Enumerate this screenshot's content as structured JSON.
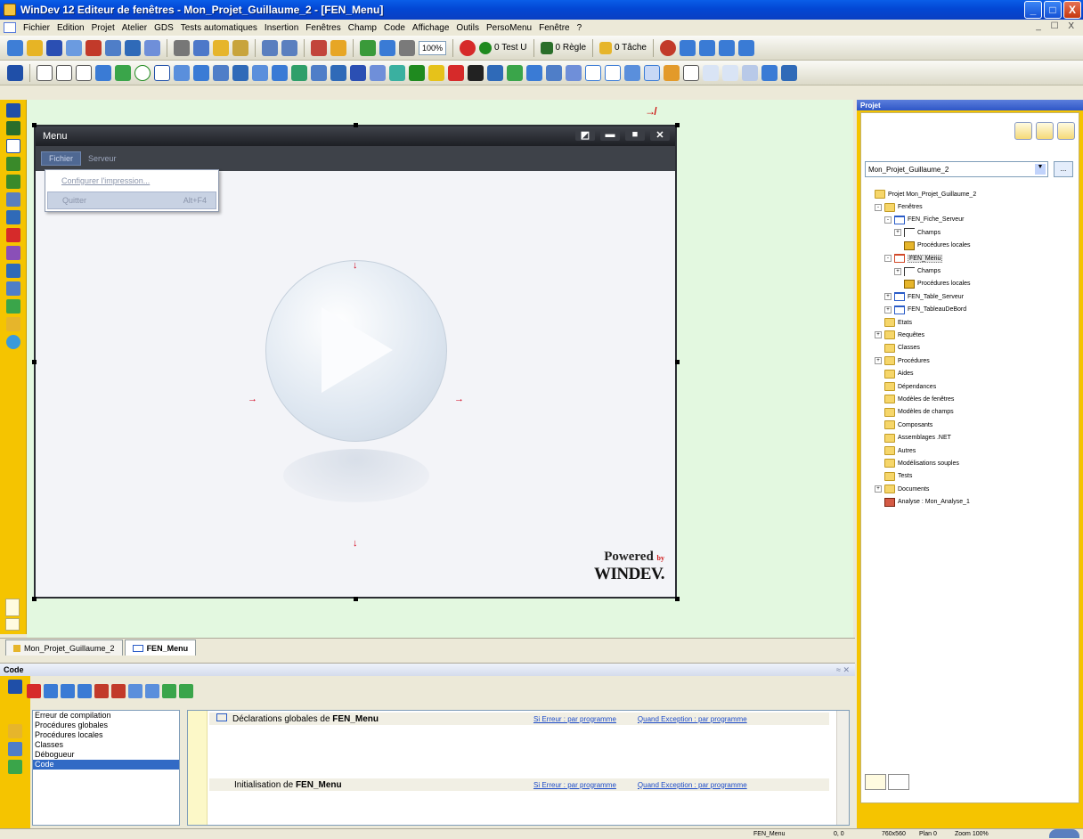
{
  "window": {
    "title": "WinDev 12  Editeur de fenêtres - Mon_Projet_Guillaume_2 - [FEN_Menu]",
    "controls": {
      "minimize": "_",
      "maximize": "□",
      "close": "X"
    }
  },
  "menubar": {
    "items": [
      "Fichier",
      "Edition",
      "Projet",
      "Atelier",
      "GDS",
      "Tests automatiques",
      "Insertion",
      "Fenêtres",
      "Champ",
      "Code",
      "Affichage",
      "Outils",
      "PersoMenu",
      "Fenêtre",
      "?"
    ],
    "mdi_controls": "_ ☐ X"
  },
  "toolbar1": {
    "zoom": "100%",
    "test_label": "0 Test U",
    "rule_label": "0 Règle",
    "task_label": "0 Tâche"
  },
  "fen": {
    "title": "Menu",
    "menu": [
      "Fichier",
      "Serveur"
    ],
    "dropdown": [
      {
        "label": "Configurer l'impression...",
        "shortcut": ""
      },
      {
        "label": "Quitter",
        "shortcut": "Alt+F4"
      }
    ],
    "powered_line1": "Powered",
    "powered_by": "by",
    "powered_line2": "WINDEV."
  },
  "doc_tabs": [
    "Mon_Projet_Guillaume_2",
    "FEN_Menu"
  ],
  "code": {
    "header": "Code",
    "categories": [
      "Erreur de compilation",
      "Procédures globales",
      "Procédures locales",
      "Classes",
      "Débogueur",
      "Code"
    ],
    "sections": [
      {
        "prefix": "Déclarations globales de ",
        "name": "FEN_Menu",
        "link1": "Si Erreur : par programme",
        "link2": "Quand Exception : par programme"
      },
      {
        "prefix": "Initialisation de ",
        "name": "FEN_Menu",
        "link1": "Si Erreur : par programme",
        "link2": "Quand Exception : par programme"
      }
    ]
  },
  "project": {
    "header": "Projet",
    "combo_value": "Mon_Projet_Guillaume_2",
    "combo_button": "...",
    "tree": [
      {
        "label": "Projet Mon_Projet_Guillaume_2",
        "depth": 0,
        "icon": "folder",
        "exp": ""
      },
      {
        "label": "Fenêtres",
        "depth": 1,
        "icon": "folder",
        "exp": "-"
      },
      {
        "label": "FEN_Fiche_Serveur",
        "depth": 2,
        "icon": "window",
        "exp": "-"
      },
      {
        "label": "Champs",
        "depth": 3,
        "icon": "fields",
        "exp": "+"
      },
      {
        "label": "Procédures locales",
        "depth": 3,
        "icon": "proc",
        "exp": ""
      },
      {
        "label": "FEN_Menu",
        "depth": 2,
        "icon": "win-sel",
        "exp": "-",
        "selected": true
      },
      {
        "label": "Champs",
        "depth": 3,
        "icon": "fields",
        "exp": "+"
      },
      {
        "label": "Procédures locales",
        "depth": 3,
        "icon": "proc",
        "exp": ""
      },
      {
        "label": "FEN_Table_Serveur",
        "depth": 2,
        "icon": "window",
        "exp": "+"
      },
      {
        "label": "FEN_TableauDeBord",
        "depth": 2,
        "icon": "window",
        "exp": "+"
      },
      {
        "label": "Etats",
        "depth": 1,
        "icon": "folder",
        "exp": ""
      },
      {
        "label": "Requêtes",
        "depth": 1,
        "icon": "folder",
        "exp": "+"
      },
      {
        "label": "Classes",
        "depth": 1,
        "icon": "folder",
        "exp": ""
      },
      {
        "label": "Procédures",
        "depth": 1,
        "icon": "folder",
        "exp": "+"
      },
      {
        "label": "Aides",
        "depth": 1,
        "icon": "folder",
        "exp": ""
      },
      {
        "label": "Dépendances",
        "depth": 1,
        "icon": "folder",
        "exp": ""
      },
      {
        "label": "Modèles de fenêtres",
        "depth": 1,
        "icon": "folder",
        "exp": ""
      },
      {
        "label": "Modèles de champs",
        "depth": 1,
        "icon": "folder",
        "exp": ""
      },
      {
        "label": "Composants",
        "depth": 1,
        "icon": "folder",
        "exp": ""
      },
      {
        "label": "Assemblages .NET",
        "depth": 1,
        "icon": "folder",
        "exp": ""
      },
      {
        "label": "Autres",
        "depth": 1,
        "icon": "folder",
        "exp": ""
      },
      {
        "label": "Modélisations souples",
        "depth": 1,
        "icon": "folder",
        "exp": ""
      },
      {
        "label": "Tests",
        "depth": 1,
        "icon": "folder",
        "exp": ""
      },
      {
        "label": "Documents",
        "depth": 1,
        "icon": "folder",
        "exp": "+"
      },
      {
        "label": "Analyse : Mon_Analyse_1",
        "depth": 1,
        "icon": "analyse",
        "exp": ""
      }
    ]
  },
  "status": {
    "window_name": "FEN_Menu",
    "position": "0, 0",
    "size": "760x560",
    "plan": "Plan 0",
    "zoom": "Zoom 100%"
  }
}
